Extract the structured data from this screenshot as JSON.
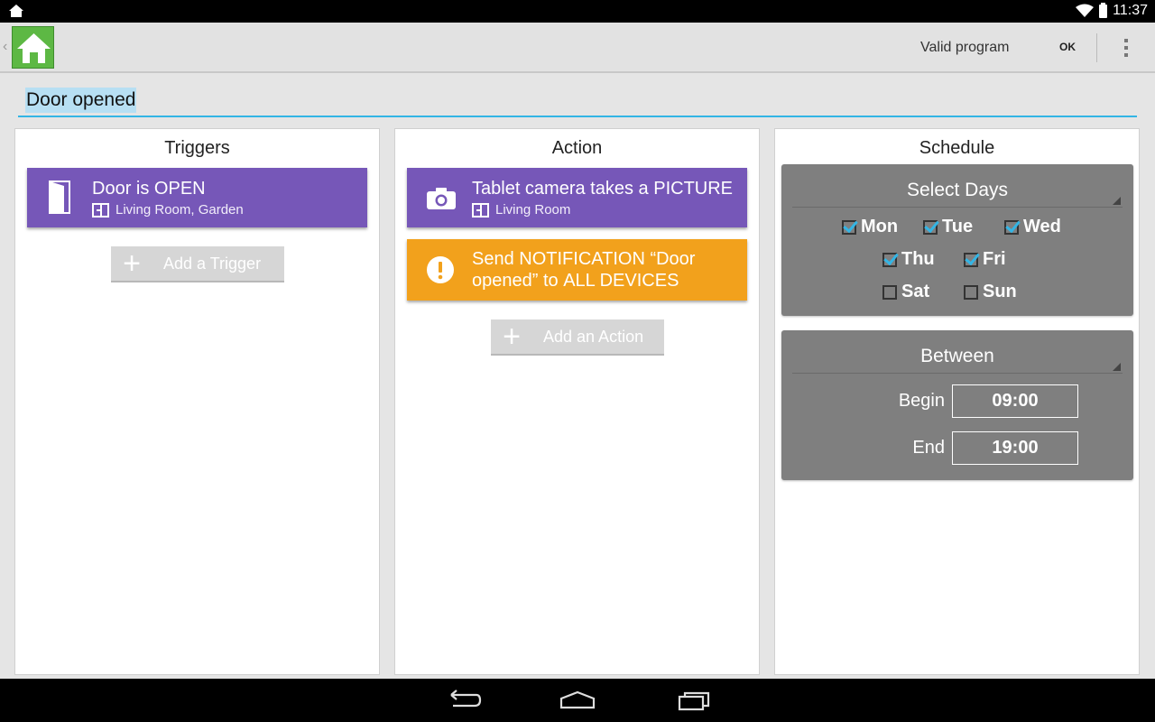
{
  "status_bar": {
    "time": "11:37",
    "icons": [
      "home-icon",
      "wifi-icon",
      "battery-icon"
    ]
  },
  "action_bar": {
    "app_icon": "home-icon",
    "title": "Valid program",
    "ok_label": "OK",
    "overflow_icon": "overflow-menu-icon"
  },
  "program": {
    "name": "Door opened"
  },
  "triggers": {
    "title": "Triggers",
    "items": [
      {
        "icon": "door-icon",
        "main_parts": [
          "Door",
          " is ",
          "OPEN"
        ],
        "rooms": "Living Room, Garden",
        "color": "#7657b8"
      }
    ],
    "add_label": "Add a Trigger"
  },
  "actions": {
    "title": "Action",
    "items": [
      {
        "icon": "camera-icon",
        "main_parts": [
          "Tablet camera",
          " takes a ",
          "PICTURE"
        ],
        "rooms": "Living Room",
        "color": "#7657b8"
      },
      {
        "icon": "alert-icon",
        "line1_parts": [
          "Send ",
          "NOTIFICATION",
          " “Door"
        ],
        "line2_parts": [
          "opened” to ",
          "ALL DEVICES"
        ],
        "color": "#f2a11c"
      }
    ],
    "add_label": "Add an Action"
  },
  "schedule": {
    "title": "Schedule",
    "days_header": "Select Days",
    "days": [
      {
        "label": "Mon",
        "checked": true
      },
      {
        "label": "Tue",
        "checked": true
      },
      {
        "label": "Wed",
        "checked": true
      },
      {
        "label": "Thu",
        "checked": true
      },
      {
        "label": "Fri",
        "checked": true
      },
      {
        "label": "Sat",
        "checked": false
      },
      {
        "label": "Sun",
        "checked": false
      }
    ],
    "between_header": "Between",
    "begin_label": "Begin",
    "begin_value": "09:00",
    "end_label": "End",
    "end_value": "19:00"
  },
  "nav_bar": {
    "buttons": [
      "back-icon",
      "home-icon",
      "recent-apps-icon"
    ]
  }
}
